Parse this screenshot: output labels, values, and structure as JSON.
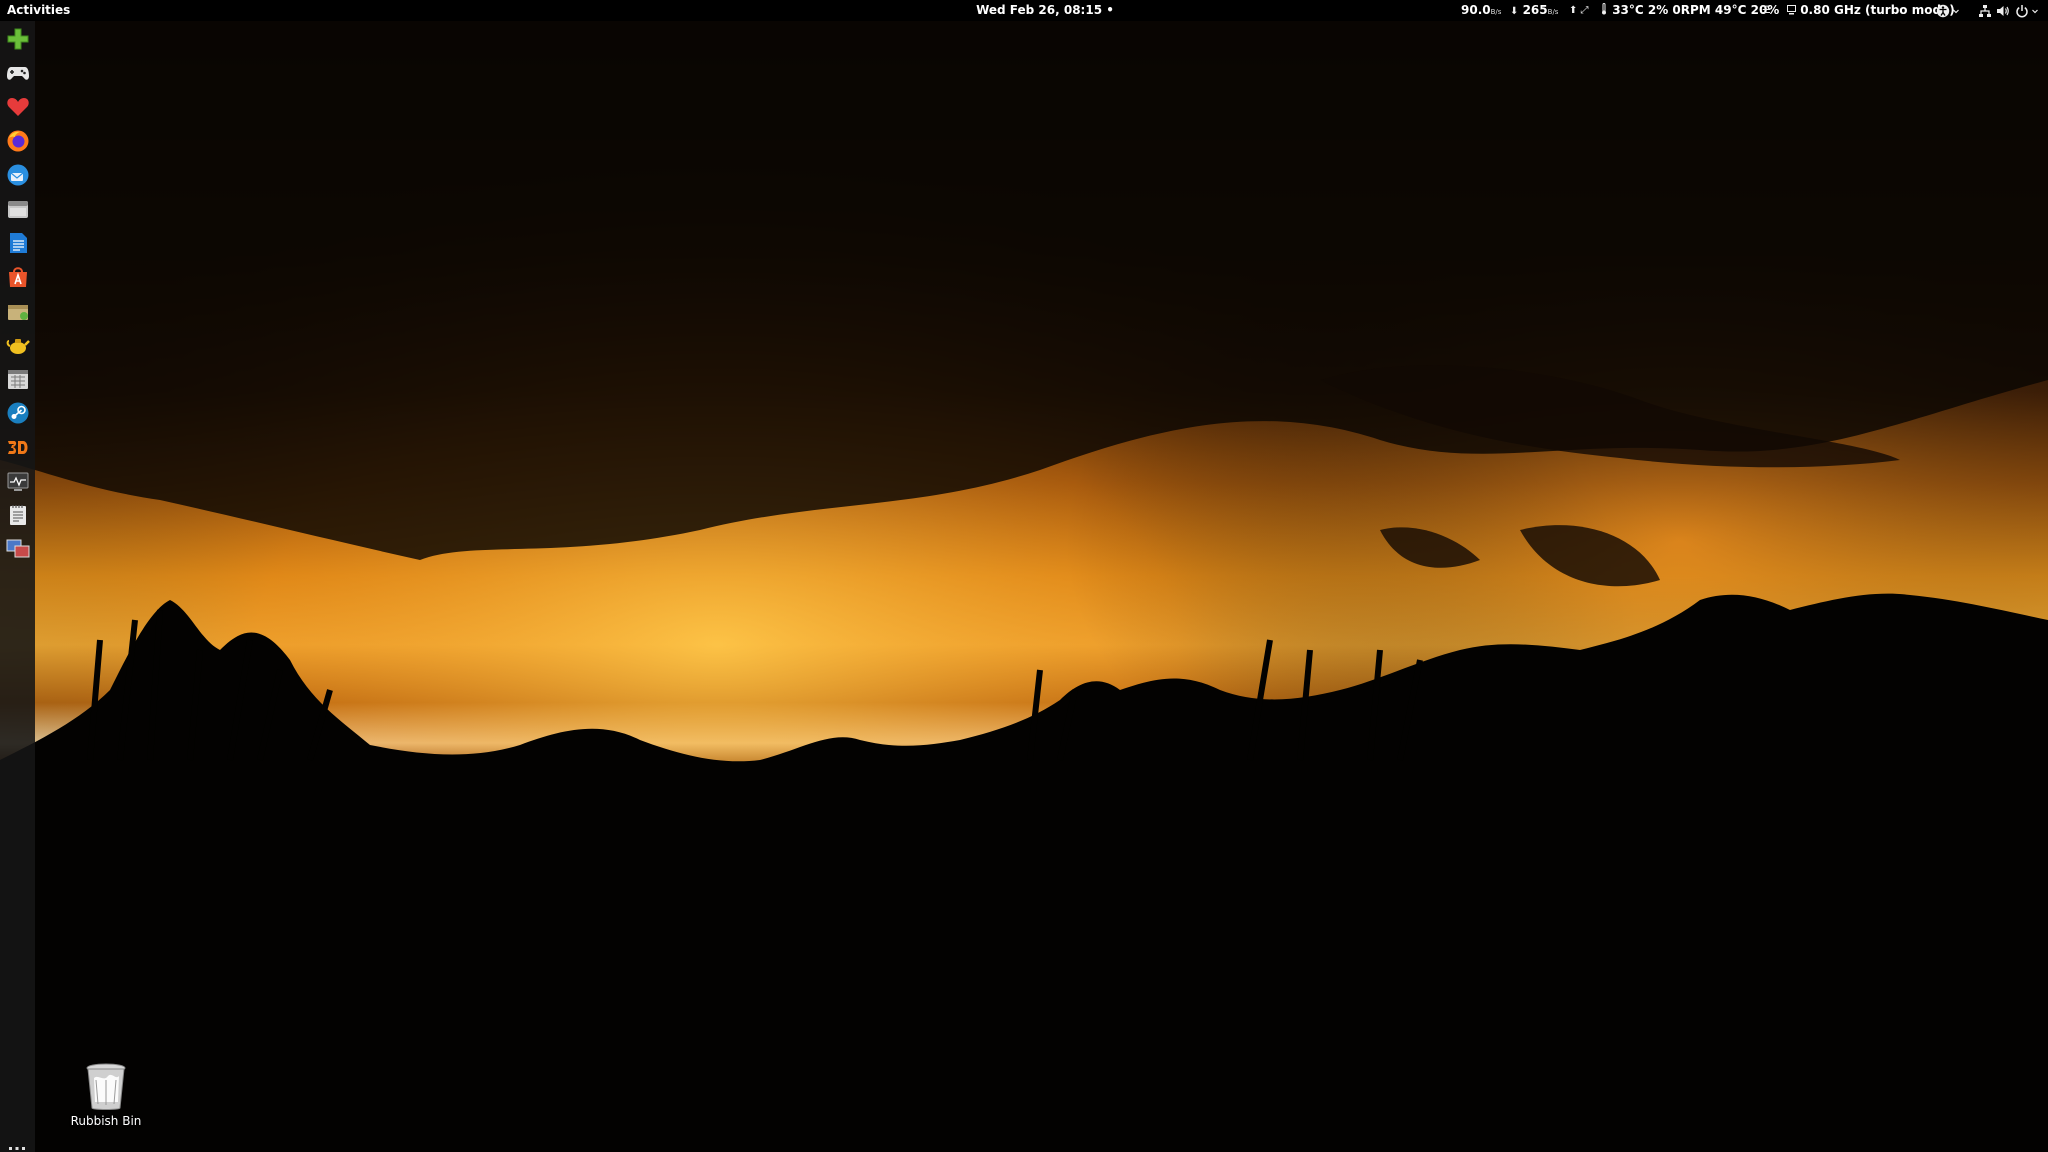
{
  "topbar": {
    "activities": "Activities",
    "clock": "Wed Feb 26, 08:15 •",
    "net_upload": {
      "value": "90.0",
      "unit": "B/s"
    },
    "net_download": {
      "arrow": "⬇",
      "value": "265",
      "unit": "B/s"
    },
    "net_arrows": "⬆ ⤢",
    "sensors": "33°C 2% 0RPM 49°C 20%",
    "menu_glyph": "☰",
    "cpu_freq": "0.80 GHz (turbo mode)"
  },
  "dock": {
    "items": [
      {
        "icon": "plus-icon",
        "color": "#6bbf3a"
      },
      {
        "icon": "gamepad-icon",
        "color": "#e6e6e6"
      },
      {
        "icon": "heart-icon",
        "color": "#e63b3b"
      },
      {
        "icon": "firefox-icon",
        "color": "#ff7a1a"
      },
      {
        "icon": "thunderbird-icon",
        "color": "#2a8fe0"
      },
      {
        "icon": "files-icon",
        "color": "#c8c8c8"
      },
      {
        "icon": "writer-icon",
        "color": "#1f7bd6"
      },
      {
        "icon": "software-center-icon",
        "color": "#e9542a"
      },
      {
        "icon": "archive-manager-icon",
        "color": "#c8b27a"
      },
      {
        "icon": "teapot-icon",
        "color": "#f0c020"
      },
      {
        "icon": "calendar-icon",
        "color": "#d8d8d8"
      },
      {
        "icon": "steam-icon",
        "color": "#1a7fbf"
      },
      {
        "icon": "3d-icon",
        "color": "#f07818"
      },
      {
        "icon": "system-monitor-icon",
        "color": "#6a6a6a"
      },
      {
        "icon": "text-editor-icon",
        "color": "#e8e8e8"
      },
      {
        "icon": "remote-desktop-icon",
        "color": "#4a78c8"
      }
    ],
    "show_apps": "show-applications-icon"
  },
  "desktop": {
    "trash_label": "Rubbish Bin"
  }
}
